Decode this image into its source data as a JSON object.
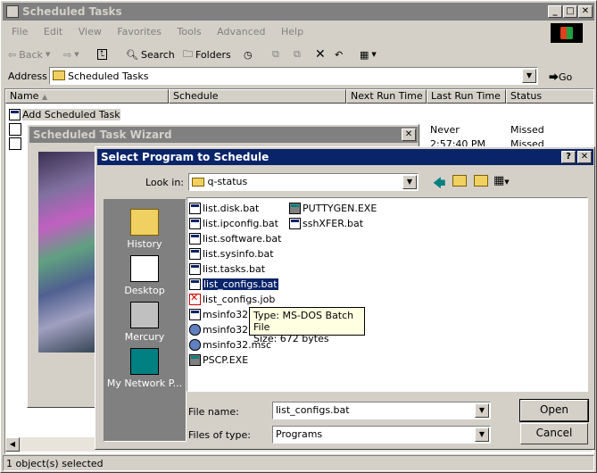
{
  "window": {
    "title": "Scheduled Tasks"
  },
  "menu": [
    "File",
    "Edit",
    "View",
    "Favorites",
    "Tools",
    "Advanced",
    "Help"
  ],
  "toolbar": {
    "back": "Back",
    "search": "Search",
    "folders": "Folders"
  },
  "address": {
    "label": "Address",
    "value": "Scheduled Tasks",
    "go": "Go"
  },
  "columns": [
    "Name",
    "Schedule",
    "Next Run Time",
    "Last Run Time",
    "Status"
  ],
  "tasks": [
    {
      "name": "Add Scheduled Task"
    },
    {
      "last_run": "Never",
      "status": "Missed"
    },
    {
      "last_run": "2:57:40 PM",
      "status": "Missed"
    }
  ],
  "status_bar": "1 object(s) selected",
  "wizard": {
    "title": "Scheduled Task Wizard"
  },
  "dialog": {
    "title": "Select Program to Schedule",
    "look_in_label": "Look in:",
    "look_in_value": "q-status",
    "places": [
      "History",
      "Desktop",
      "Mercury",
      "My Network P..."
    ],
    "files_col1": [
      {
        "name": "list.disk.bat",
        "type": "bat"
      },
      {
        "name": "list.ipconfig.bat",
        "type": "bat"
      },
      {
        "name": "list.software.bat",
        "type": "bat"
      },
      {
        "name": "list.sysinfo.bat",
        "type": "bat"
      },
      {
        "name": "list.tasks.bat",
        "type": "bat"
      },
      {
        "name": "list_configs.bat",
        "type": "bat"
      },
      {
        "name": "list_configs.job",
        "type": "job"
      },
      {
        "name": "msinfo32.",
        "type": "bat"
      },
      {
        "name": "msinfo32.",
        "type": "msc"
      },
      {
        "name": "msinfo32.msc",
        "type": "msc"
      },
      {
        "name": "PSCP.EXE",
        "type": "exe"
      }
    ],
    "files_col2": [
      {
        "name": "PUTTYGEN.EXE",
        "type": "exe"
      },
      {
        "name": "sshXFER.bat",
        "type": "bat"
      }
    ],
    "tooltip": {
      "line1": "Type: MS-DOS Batch File",
      "line2": "Size: 672 bytes"
    },
    "file_name_label": "File name:",
    "file_name_value": "list_configs.bat",
    "files_of_type_label": "Files of type:",
    "files_of_type_value": "Programs",
    "open": "Open",
    "cancel": "Cancel"
  }
}
